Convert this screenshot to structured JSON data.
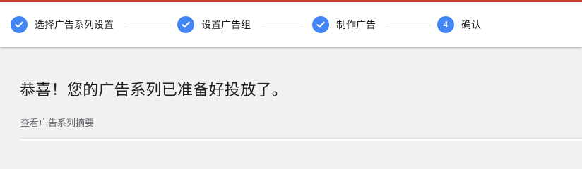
{
  "colors": {
    "accent": "#d33a2c",
    "step_active": "#4285f4"
  },
  "stepper": {
    "steps": [
      {
        "label": "选择广告系列设置",
        "status": "completed",
        "icon": "check-icon"
      },
      {
        "label": "设置广告组",
        "status": "completed",
        "icon": "check-icon"
      },
      {
        "label": "制作广告",
        "status": "completed",
        "icon": "check-icon"
      },
      {
        "label": "确认",
        "status": "current",
        "number": "4"
      }
    ]
  },
  "main": {
    "title": "恭喜！您的广告系列已准备好投放了。",
    "summary_caption": "查看广告系列摘要"
  }
}
